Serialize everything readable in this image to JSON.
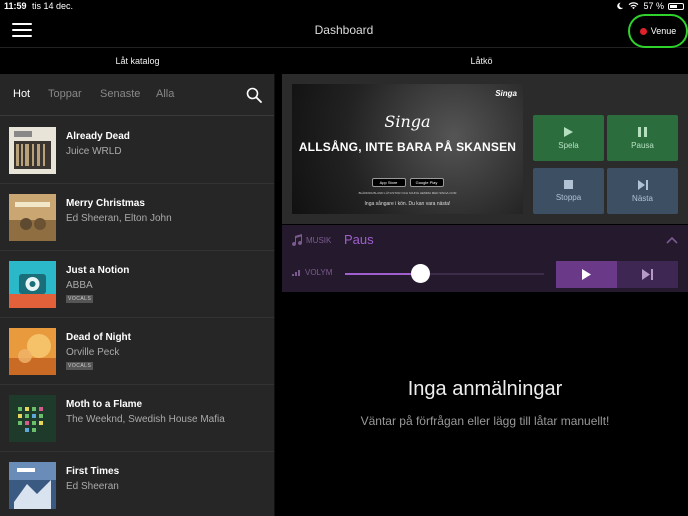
{
  "status": {
    "time": "11:59",
    "date": "tis 14 dec.",
    "battery": "57 %",
    "battery_level": 0.57
  },
  "header": {
    "title": "Dashboard",
    "venue_label": "Venue"
  },
  "subheader": {
    "catalog_label": "Låt katalog",
    "queue_label": "Låtkö"
  },
  "catalog": {
    "tabs": [
      {
        "label": "Hot"
      },
      {
        "label": "Toppar"
      },
      {
        "label": "Senaste"
      },
      {
        "label": "Alla"
      }
    ],
    "songs": [
      {
        "title": "Already Dead",
        "artist": "Juice WRLD",
        "badge": ""
      },
      {
        "title": "Merry Christmas",
        "artist": "Ed Sheeran, Elton John",
        "badge": ""
      },
      {
        "title": "Just a Notion",
        "artist": "ABBA",
        "badge": "VOCALS"
      },
      {
        "title": "Dead of Night",
        "artist": "Orville Peck",
        "badge": "VOCALS"
      },
      {
        "title": "Moth to a Flame",
        "artist": "The Weeknd, Swedish House Mafia",
        "badge": ""
      },
      {
        "title": "First Times",
        "artist": "Ed Sheeran",
        "badge": ""
      }
    ]
  },
  "banner": {
    "logo_small": "Singa",
    "logo": "Singa",
    "headline": "ALLSÅNG, INTE BARA PÅ SKANSEN",
    "app_store": "App Store",
    "google_play": "Google Play",
    "small_text": "BLÄDDRA BLAND LÅTLISTOR OCH SJUNG HEMMA MED SINGA.COM",
    "footer": "Inga sångare i kön. Du kan vara nästa!"
  },
  "controls": {
    "play": "Spela",
    "pause": "Pausa",
    "stop": "Stoppa",
    "next": "Nästa"
  },
  "music": {
    "label": "MUSIK",
    "state": "Paus",
    "volume_label": "VOLYM",
    "volume": 0.38
  },
  "queue": {
    "empty_title": "Inga anmälningar",
    "empty_subtitle": "Väntar på förfrågan eller lägg till låtar manuellt!"
  },
  "colors": {
    "accent": "#9f5fcd",
    "venue_ring": "#2ed22a",
    "venue_dot": "#e0202a"
  }
}
